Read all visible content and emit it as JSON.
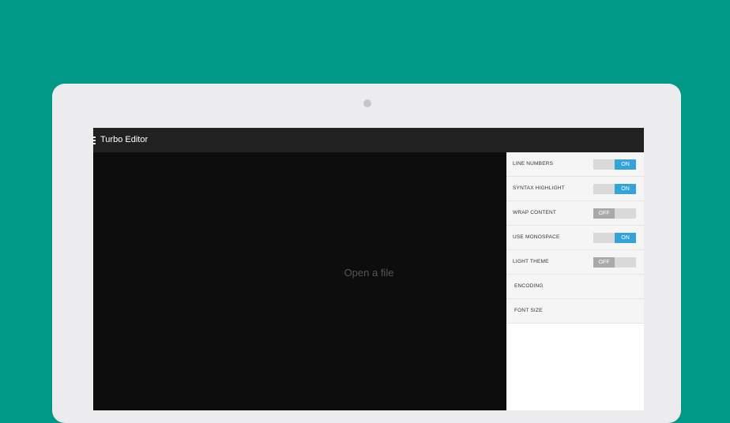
{
  "app": {
    "title": "Turbo Editor"
  },
  "editor": {
    "empty_text": "Open a file"
  },
  "settings": {
    "items": [
      {
        "label": "LINE NUMBERS",
        "state": "ON"
      },
      {
        "label": "SYNTAX HIGHLIGHT",
        "state": "ON"
      },
      {
        "label": "WRAP CONTENT",
        "state": "OFF"
      },
      {
        "label": "USE MONOSPACE",
        "state": "ON"
      },
      {
        "label": "LIGHT THEME",
        "state": "OFF"
      },
      {
        "label": "ENCODING"
      },
      {
        "label": "FONT SIZE"
      }
    ]
  },
  "colors": {
    "background": "#009987",
    "toggle_on": "#33a3d8",
    "toggle_off": "#a9a9a9"
  }
}
